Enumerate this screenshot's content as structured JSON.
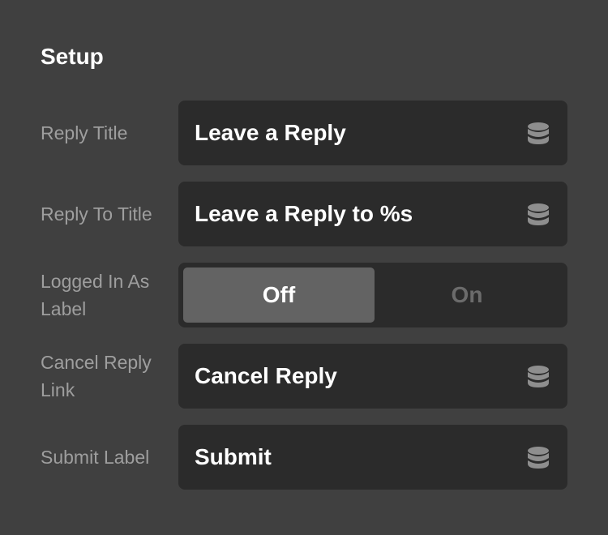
{
  "section": {
    "title": "Setup"
  },
  "fields": [
    {
      "label": "Reply Title",
      "value": "Leave a Reply",
      "icon": "database-icon"
    },
    {
      "label": "Reply To Title",
      "value": "Leave a Reply to %s",
      "icon": "database-icon"
    },
    {
      "label": "Cancel Reply Link",
      "value": "Cancel Reply",
      "icon": "database-icon"
    },
    {
      "label": "Submit Label",
      "value": "Submit",
      "icon": "database-icon"
    }
  ],
  "logged_in_toggle": {
    "label": "Logged In As Label",
    "off_label": "Off",
    "on_label": "On",
    "selected": "Off"
  },
  "colors": {
    "background": "#404040",
    "field_background": "#2b2b2b",
    "toggle_selected": "#636363",
    "label_text": "#9e9e9e",
    "value_text": "#ffffff",
    "icon": "#8e8e8e"
  }
}
